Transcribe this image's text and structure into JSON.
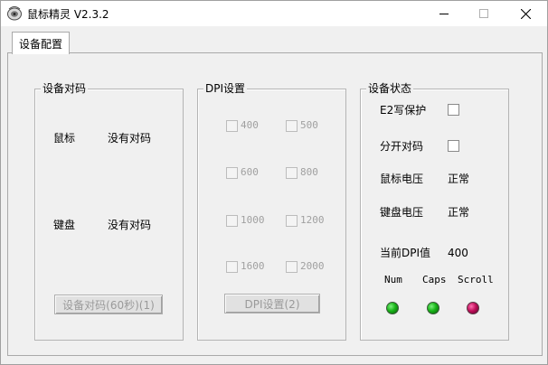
{
  "window": {
    "title": "鼠标精灵 V2.3.2",
    "app_icon": "mouse-icon"
  },
  "titlebar": {
    "minimize_icon": "minimize-icon",
    "maximize_icon": "maximize-icon",
    "close_icon": "close-icon"
  },
  "tabs": [
    {
      "label": "设备配置",
      "selected": true
    }
  ],
  "pairing": {
    "title": "设备对码",
    "mouse_label": "鼠标",
    "mouse_status": "没有对码",
    "keyboard_label": "键盘",
    "keyboard_status": "没有对码",
    "pair_button": "设备对码(60秒)(1)"
  },
  "dpi": {
    "title": "DPI设置",
    "options": [
      "400",
      "500",
      "600",
      "800",
      "1000",
      "1200",
      "1600",
      "2000"
    ],
    "set_button": "DPI设置(2)"
  },
  "status": {
    "title": "设备状态",
    "e2_write_protect": "E2写保护",
    "split_pairing": "分开对码",
    "mouse_voltage_label": "鼠标电压",
    "mouse_voltage_value": "正常",
    "keyboard_voltage_label": "键盘电压",
    "keyboard_voltage_value": "正常",
    "current_dpi_label": "当前DPI值",
    "current_dpi_value": "400",
    "indicators": [
      {
        "label": "Num",
        "color": "#18b418",
        "state": "on"
      },
      {
        "label": "Caps",
        "color": "#18b418",
        "state": "on"
      },
      {
        "label": "Scroll",
        "color": "#c0105a",
        "state": "on"
      }
    ]
  }
}
